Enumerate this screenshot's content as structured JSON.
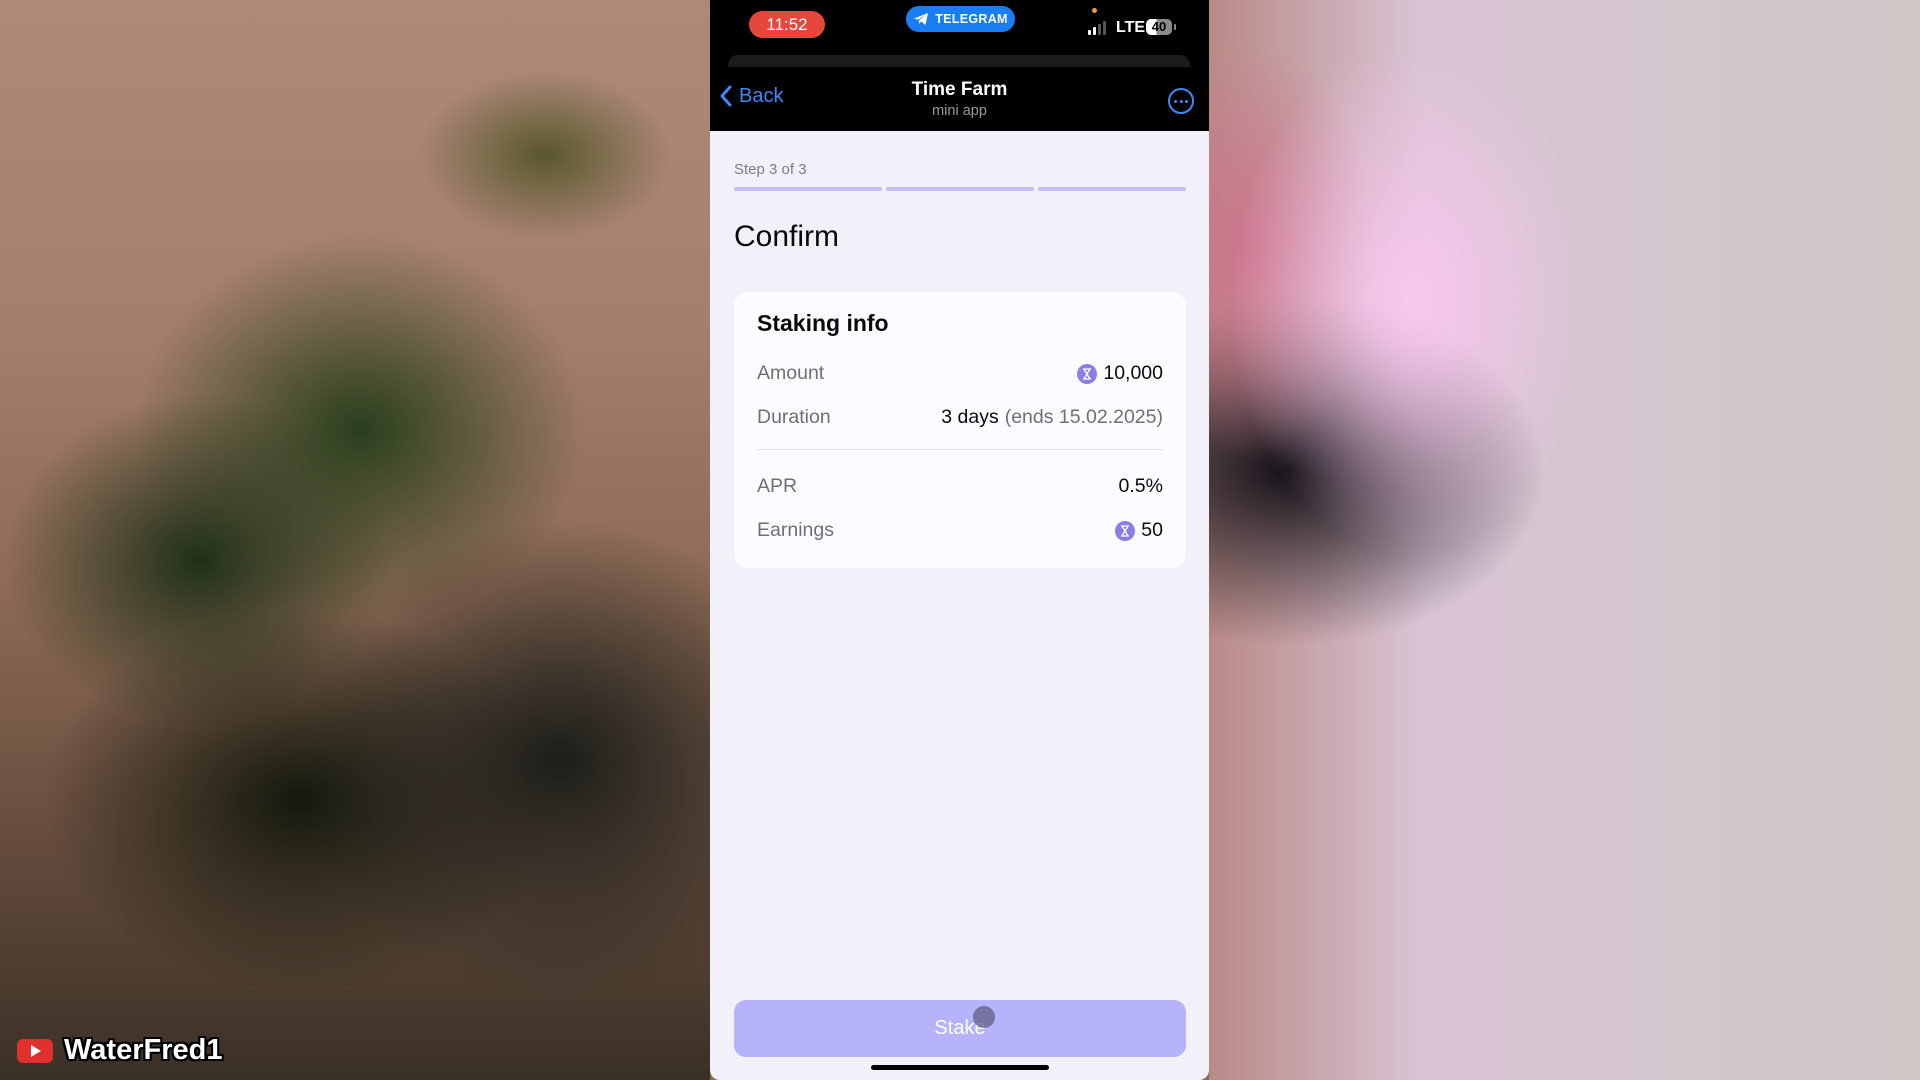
{
  "status_bar": {
    "time": "11:52",
    "app_pill": "TELEGRAM",
    "network": "LTE",
    "battery": "40",
    "colors": {
      "time_pill": "#e5483a",
      "app_pill": "#1a7ef2"
    }
  },
  "nav": {
    "back_label": "Back",
    "title": "Time Farm",
    "subtitle": "mini app",
    "more_icon": "more-horizontal-circle-icon",
    "accent": "#3e88f7"
  },
  "stepper": {
    "label": "Step 3 of 3",
    "current": 3,
    "total": 3
  },
  "page": {
    "title": "Confirm"
  },
  "staking_info": {
    "title": "Staking info",
    "rows": [
      {
        "label": "Amount",
        "value": "10,000",
        "icon": "time-coin-icon"
      },
      {
        "label": "Duration",
        "value": "3 days",
        "detail": "(ends 15.02.2025)"
      },
      {
        "label": "APR",
        "value": "0.5%"
      },
      {
        "label": "Earnings",
        "value": "50",
        "icon": "time-coin-icon"
      }
    ],
    "coin_color": "#8a7fe6"
  },
  "actions": {
    "stake_label": "Stake",
    "stake_color": "#b6b2fb"
  },
  "watermark": {
    "channel": "WaterFred1",
    "icon": "youtube-icon"
  }
}
